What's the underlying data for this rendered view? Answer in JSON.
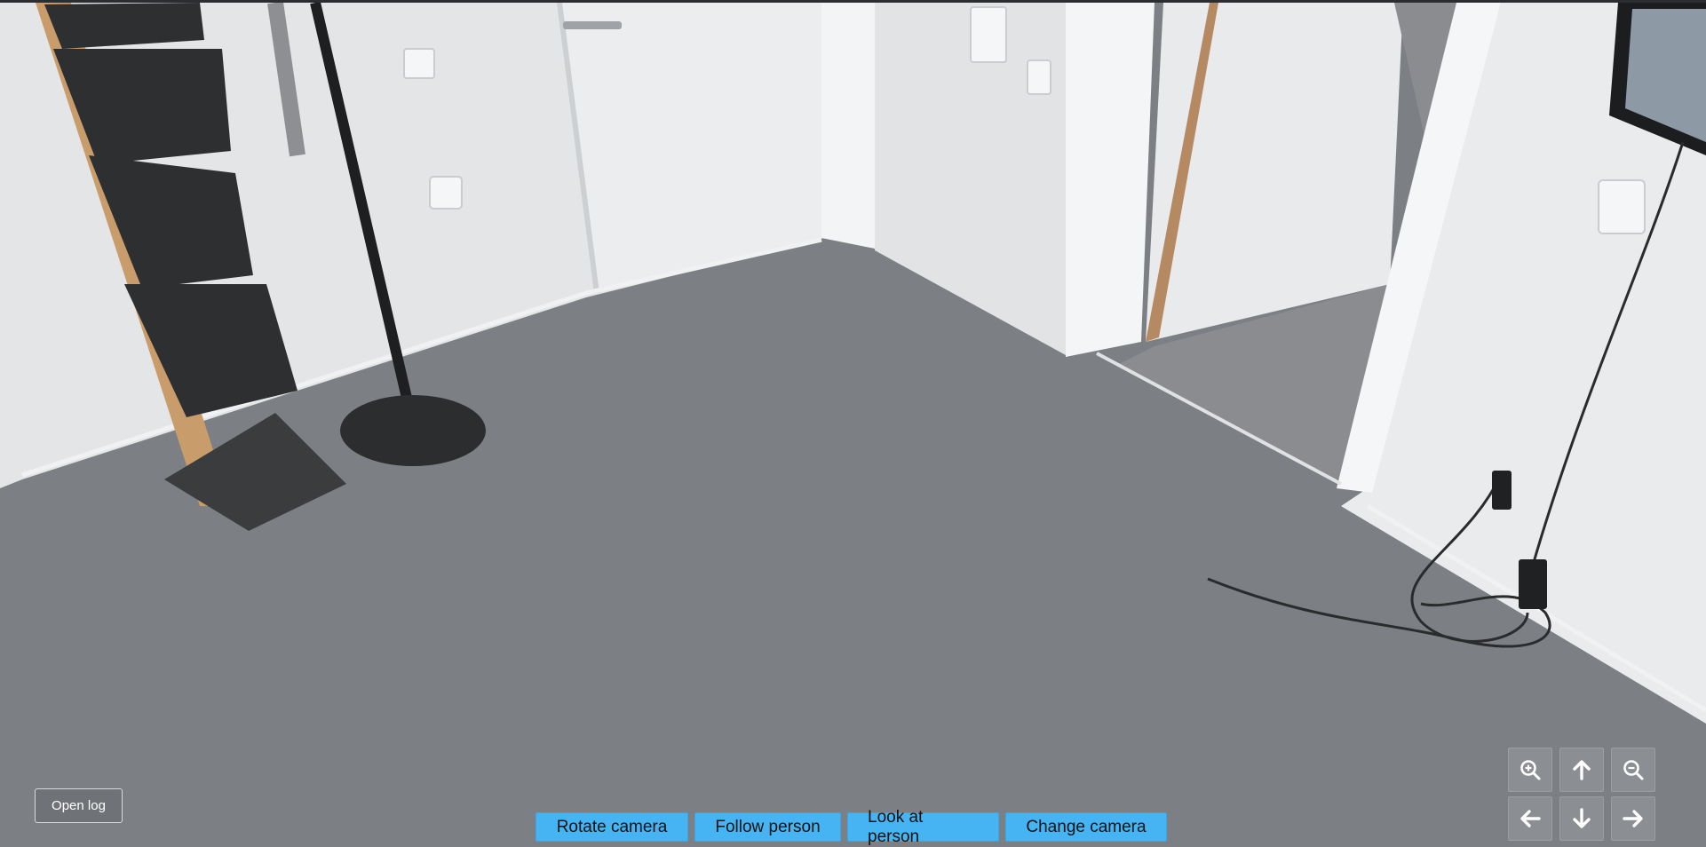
{
  "controls": {
    "open_log_label": "Open log",
    "actions": {
      "rotate_label": "Rotate camera",
      "follow_label": "Follow person",
      "look_label": "Look at person",
      "change_label": "Change camera"
    },
    "ptz_icons": [
      "zoom-in-icon",
      "arrow-up-icon",
      "zoom-out-icon",
      "arrow-left-icon",
      "arrow-down-icon",
      "arrow-right-icon"
    ]
  },
  "colors": {
    "action_button": "#46b4f2",
    "ptz_button": "#8b8e92",
    "floor": "#7c7f84",
    "wall": "#e6e8ea"
  }
}
